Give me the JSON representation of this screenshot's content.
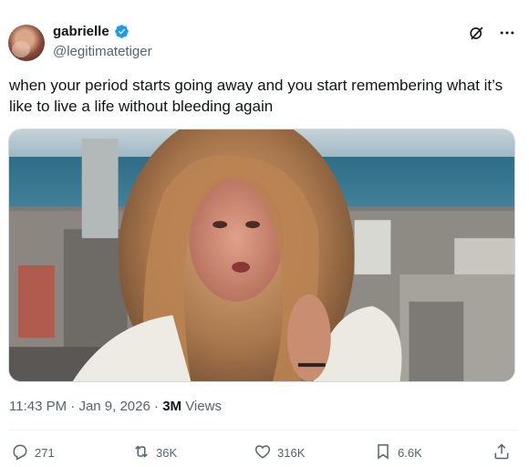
{
  "user": {
    "display_name": "gabrielle",
    "handle": "@legitimatetiger",
    "verified_icon": "verified-badge-icon",
    "avatar_icon": "avatar"
  },
  "tweet": {
    "text": "when your period starts going away and you start remembering what it’s like to live a life without bleeding again",
    "time": "11:43 PM",
    "separator": "·",
    "date": "Jan 9, 2026",
    "views_count": "3M",
    "views_label": "Views",
    "media_icon": "video-thumbnail"
  },
  "header_icons": [
    "grok-icon",
    "more-icon"
  ],
  "actions": {
    "reply": "271",
    "repost": "36K",
    "like": "316K",
    "bookmark": "6.6K",
    "share_icon": "share-icon"
  },
  "colors": {
    "verified_blue": "#1d9bf0",
    "secondary_text": "#536471",
    "primary_text": "#0f1419"
  }
}
